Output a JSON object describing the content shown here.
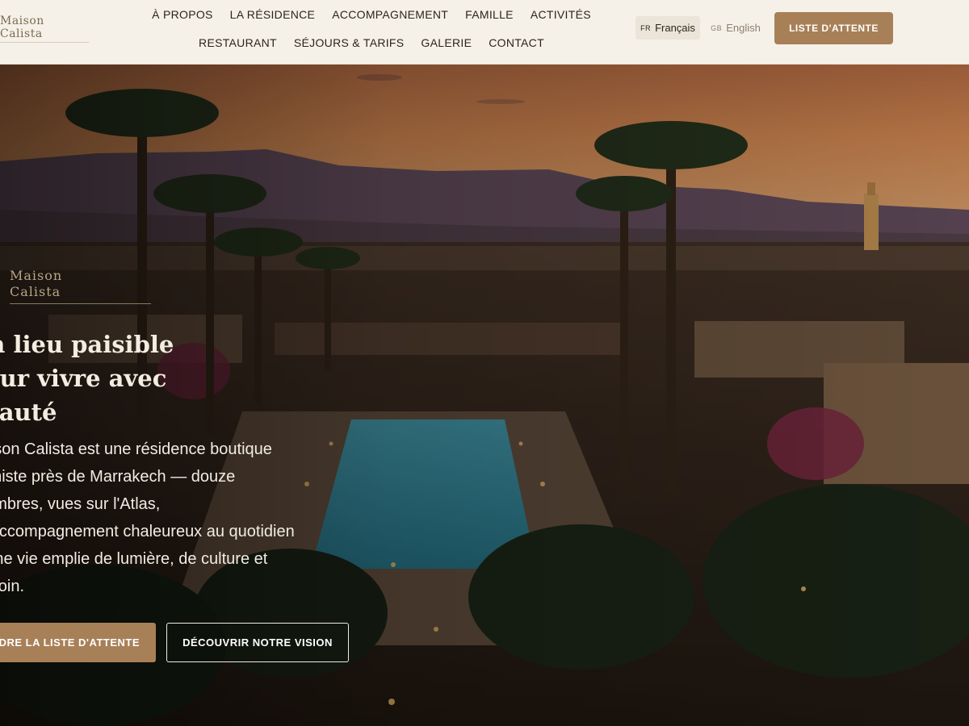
{
  "brand": {
    "line1": "Maison",
    "line2": "Calista"
  },
  "nav": {
    "row1": [
      "À PROPOS",
      "LA RÉSIDENCE",
      "ACCOMPAGNEMENT",
      "FAMILLE",
      "ACTIVITÉS"
    ],
    "row2": [
      "RESTAURANT",
      "SÉJOURS & TARIFS",
      "GALERIE",
      "CONTACT"
    ]
  },
  "languages": {
    "french": {
      "code": "FR",
      "label": "Français"
    },
    "english": {
      "code": "GB",
      "label": "English"
    }
  },
  "header_cta": "LISTE D'ATTENTE",
  "hero": {
    "logo_line1": "Maison",
    "logo_line2": "Calista",
    "title_lines": [
      "Un lieu paisible",
      "pour vivre avec",
      "beauté"
    ],
    "body_lines": [
      "Maison Calista est une résidence boutique",
      "intimiste près de Marrakech — douze",
      "chambres, vues sur l'Atlas,",
      "un accompagnement chaleureux au quotidien",
      "et une vie emplie de lumière, de culture et",
      "de soin."
    ],
    "primary_cta": "REJOINDRE LA LISTE D'ATTENTE",
    "secondary_cta": "DÉCOUVRIR NOTRE VISION"
  },
  "colors": {
    "accent": "#a88057",
    "header_bg": "#f6f1e8",
    "nav_text": "#2b241b"
  }
}
